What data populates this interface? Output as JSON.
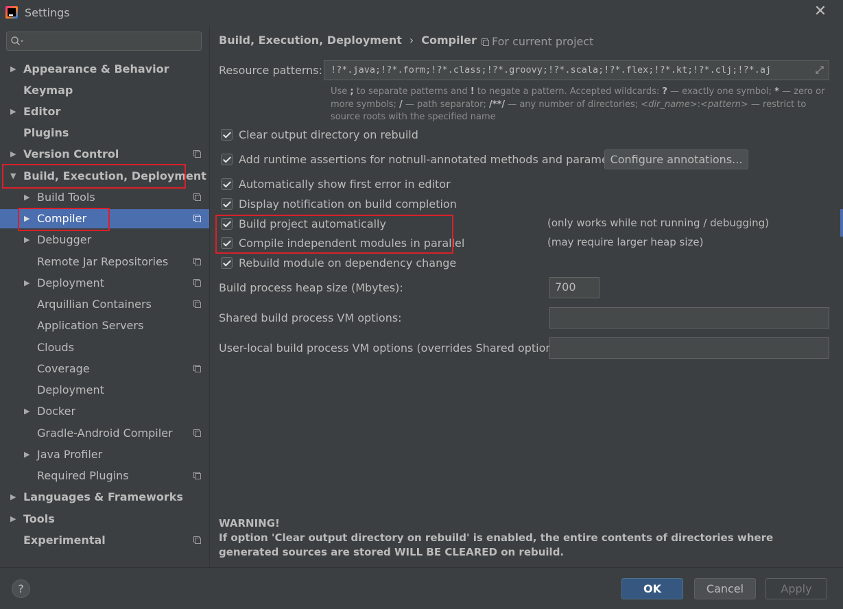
{
  "window": {
    "title": "Settings",
    "close_icon": "close-icon"
  },
  "sidebar": {
    "search": {
      "placeholder": "",
      "icon": "search-icon"
    },
    "items": [
      {
        "label": "Appearance & Behavior",
        "arrow": "▶"
      },
      {
        "label": "Keymap"
      },
      {
        "label": "Editor",
        "arrow": "▶"
      },
      {
        "label": "Plugins"
      },
      {
        "label": "Version Control",
        "arrow": "▶"
      },
      {
        "label": "Build, Execution, Deployment",
        "arrow": "▼"
      },
      {
        "label": "Build Tools",
        "arrow": "▶"
      },
      {
        "label": "Compiler",
        "arrow": "▶"
      },
      {
        "label": "Debugger",
        "arrow": "▶"
      },
      {
        "label": "Remote Jar Repositories"
      },
      {
        "label": "Deployment",
        "arrow": "▶"
      },
      {
        "label": "Arquillian Containers"
      },
      {
        "label": "Application Servers"
      },
      {
        "label": "Clouds"
      },
      {
        "label": "Coverage"
      },
      {
        "label": "Deployment"
      },
      {
        "label": "Docker",
        "arrow": "▶"
      },
      {
        "label": "Gradle-Android Compiler"
      },
      {
        "label": "Java Profiler",
        "arrow": "▶"
      },
      {
        "label": "Required Plugins"
      },
      {
        "label": "Languages & Frameworks",
        "arrow": "▶"
      },
      {
        "label": "Tools",
        "arrow": "▶"
      },
      {
        "label": "Experimental"
      }
    ]
  },
  "breadcrumb": {
    "parent": "Build, Execution, Deployment",
    "separator": "›",
    "current": "Compiler"
  },
  "scope_label": "For current project",
  "resource": {
    "label": "Resource patterns:",
    "value": "!?*.java;!?*.form;!?*.class;!?*.groovy;!?*.scala;!?*.flex;!?*.kt;!?*.clj;!?*.aj",
    "hint": {
      "t1": "Use ",
      "b1": ";",
      "t2": " to separate patterns and ",
      "b2": "!",
      "t3": " to negate a pattern. Accepted wildcards: ",
      "b3": "?",
      "t4": " — exactly one symbol; ",
      "b4": "*",
      "t5": " — zero or more symbols; ",
      "b5": "/",
      "t6": " — path separator; ",
      "b6": "/**/",
      "t7": " — any number of directories; ",
      "i1": "<dir_name>",
      "t8": ":",
      "i2": "<pattern>",
      "t9": " — restrict to source roots with the specified name"
    }
  },
  "options": {
    "clear_output": {
      "label": "Clear output directory on rebuild",
      "checked": true
    },
    "runtime_assertions": {
      "label": "Add runtime assertions for notnull-annotated methods and parameters",
      "checked": true
    },
    "configure_annotations": "Configure annotations...",
    "show_first_error": {
      "label": "Automatically show first error in editor",
      "checked": true
    },
    "display_notification": {
      "label": "Display notification on build completion",
      "checked": true
    },
    "build_auto": {
      "label": "Build project automatically",
      "checked": true,
      "note": "(only works while not running / debugging)"
    },
    "compile_parallel": {
      "label": "Compile independent modules in parallel",
      "checked": true,
      "note": "(may require larger heap size)"
    },
    "rebuild_on_change": {
      "label": "Rebuild module on dependency change",
      "checked": true
    }
  },
  "heap": {
    "label": "Build process heap size (Mbytes):",
    "value": "700"
  },
  "shared_vm": {
    "label": "Shared build process VM options:",
    "value": ""
  },
  "user_vm": {
    "label": "User-local build process VM options (overrides Shared options):",
    "value": ""
  },
  "warning": {
    "title": "WARNING!",
    "text": "If option 'Clear output directory on rebuild' is enabled, the entire contents of directories where generated sources are stored WILL BE CLEARED on rebuild."
  },
  "footer": {
    "help": "?",
    "ok": "OK",
    "cancel": "Cancel",
    "apply": "Apply"
  },
  "colors": {
    "background": "#3c3f41",
    "selection": "#4b6eaf",
    "highlight_box": "#d9202a",
    "ok_button": "#365880"
  }
}
